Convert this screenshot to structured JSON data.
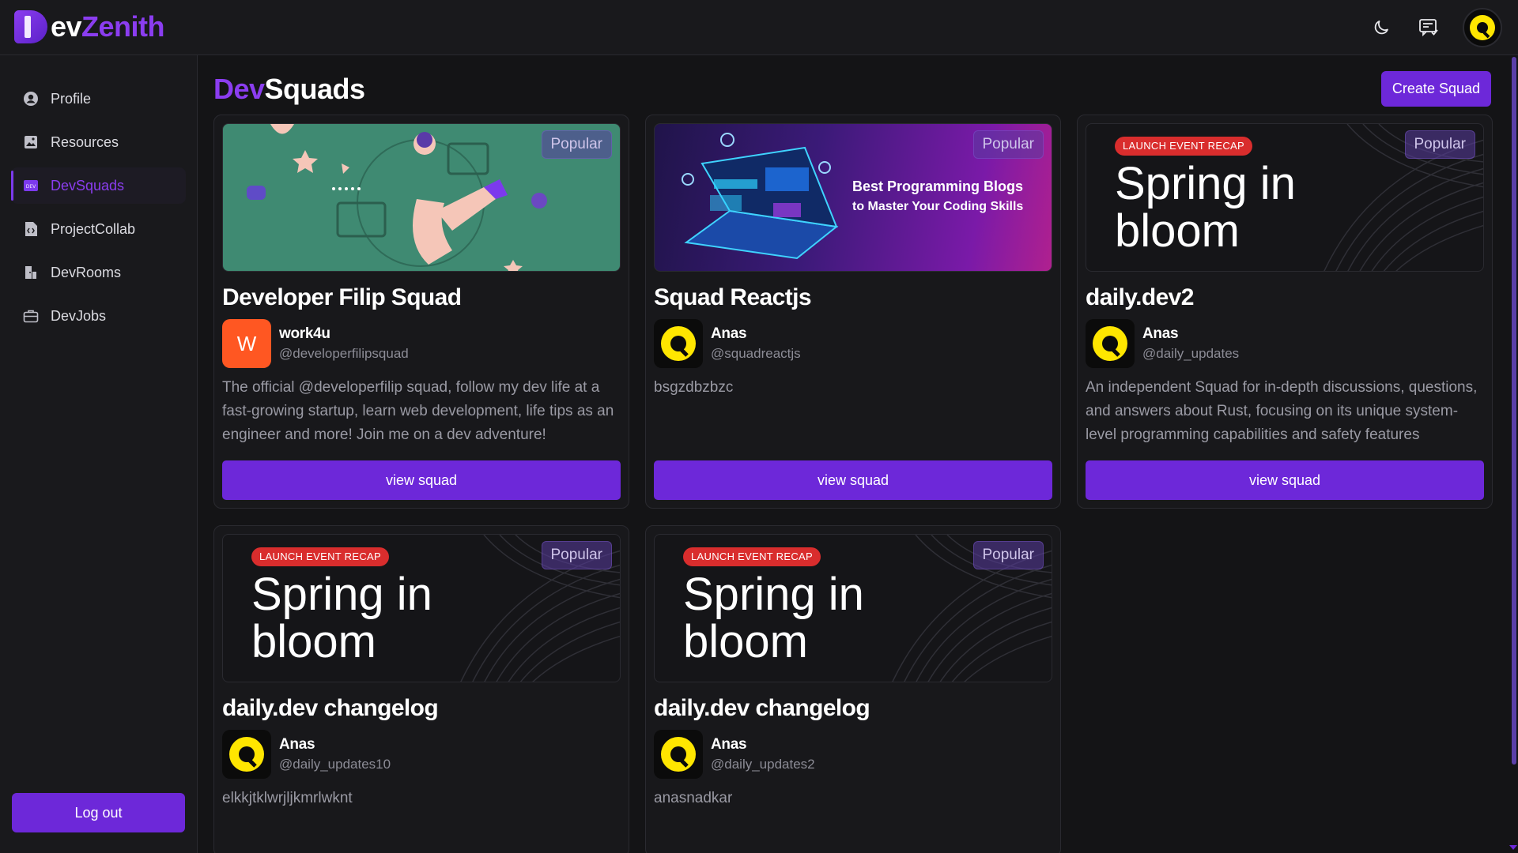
{
  "brand": {
    "prefix": "D",
    "name_white": "ev",
    "name_purple": "Zenith"
  },
  "header": {
    "icons": [
      "moon-icon",
      "chat-icon",
      "user-avatar"
    ]
  },
  "sidebar": {
    "items": [
      {
        "label": "Profile",
        "icon": "user-circle-icon",
        "active": false
      },
      {
        "label": "Resources",
        "icon": "image-icon",
        "active": false
      },
      {
        "label": "DevSquads",
        "icon": "dev-badge-icon",
        "active": true
      },
      {
        "label": "ProjectCollab",
        "icon": "code-file-icon",
        "active": false
      },
      {
        "label": "DevRooms",
        "icon": "room-icon",
        "active": false
      },
      {
        "label": "DevJobs",
        "icon": "briefcase-icon",
        "active": false
      }
    ],
    "logout_label": "Log out"
  },
  "page": {
    "title_purple": "Dev",
    "title_white": "Squads",
    "create_label": "Create Squad"
  },
  "cards": [
    {
      "title": "Developer Filip Squad",
      "owner": "work4u",
      "handle": "@developerfilipsquad",
      "avatar": "W",
      "description": "The official @developerfilip squad, follow my dev life at a fast-growing startup, learn web development, life tips as an engineer and more! Join me on a dev adventure!",
      "badge": "Popular",
      "button": "view squad"
    },
    {
      "title": "Squad Reactjs",
      "owner": "Anas",
      "handle": "@squadreactjs",
      "description": "bsgzdbzbzc",
      "badge": "Popular",
      "banner_line1": "Best Programming Blogs",
      "banner_line2": "to Master Your Coding Skills",
      "button": "view squad"
    },
    {
      "title": "daily.dev2",
      "owner": "Anas",
      "handle": "@daily_updates",
      "description": "An independent Squad for in-depth discussions, questions, and answers about Rust, focusing on its unique system-level programming capabilities and safety features",
      "badge": "Popular",
      "tag": "LAUNCH EVENT RECAP",
      "banner_line1": "Spring in",
      "banner_line2": "bloom",
      "button": "view squad"
    },
    {
      "title": "daily.dev changelog",
      "owner": "Anas",
      "handle": "@daily_updates10",
      "description": "elkkjtklwrjljkmrlwknt",
      "badge": "Popular",
      "tag": "LAUNCH EVENT RECAP",
      "banner_line1": "Spring in",
      "banner_line2": "bloom"
    },
    {
      "title": "daily.dev changelog",
      "owner": "Anas",
      "handle": "@daily_updates2",
      "description": "anasnadkar",
      "badge": "Popular",
      "tag": "LAUNCH EVENT RECAP",
      "banner_line1": "Spring in",
      "banner_line2": "bloom"
    }
  ],
  "colors": {
    "accent": "#6d28d9",
    "brand_purple": "#8b3df0",
    "background": "#141416",
    "tag_red": "#d92d2d",
    "avatar_yellow": "#ffe600"
  }
}
